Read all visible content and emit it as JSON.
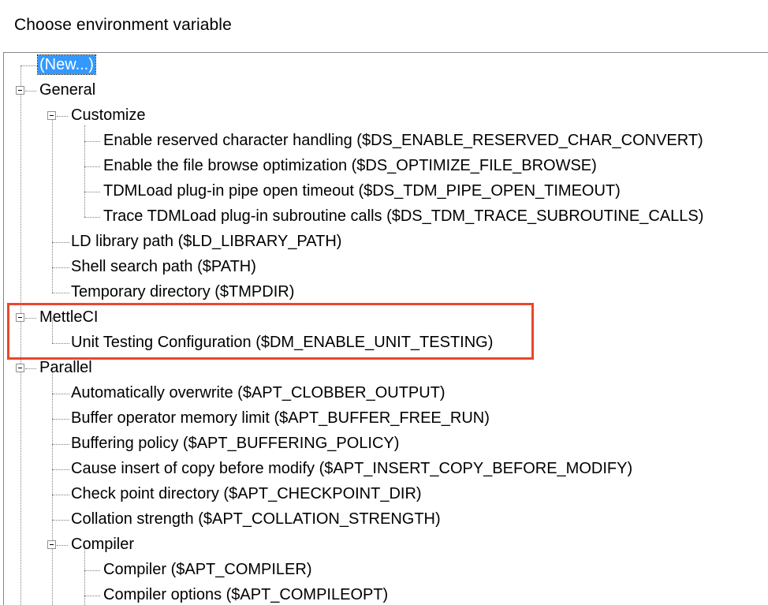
{
  "window": {
    "title": "Choose environment variable"
  },
  "tree": {
    "new_item": "(New...)",
    "general": {
      "label": "General",
      "customize": {
        "label": "Customize",
        "items": [
          "Enable reserved character handling ($DS_ENABLE_RESERVED_CHAR_CONVERT)",
          "Enable the file browse optimization ($DS_OPTIMIZE_FILE_BROWSE)",
          "TDMLoad plug-in pipe open timeout ($DS_TDM_PIPE_OPEN_TIMEOUT)",
          "Trace TDMLoad plug-in subroutine calls ($DS_TDM_TRACE_SUBROUTINE_CALLS)"
        ]
      },
      "items": [
        "LD library path ($LD_LIBRARY_PATH)",
        "Shell search path ($PATH)",
        "Temporary directory ($TMPDIR)"
      ]
    },
    "mettleci": {
      "label": "MettleCI",
      "items": [
        "Unit Testing Configuration ($DM_ENABLE_UNIT_TESTING)"
      ]
    },
    "parallel": {
      "label": "Parallel",
      "items": [
        "Automatically overwrite ($APT_CLOBBER_OUTPUT)",
        "Buffer operator memory limit ($APT_BUFFER_FREE_RUN)",
        "Buffering policy ($APT_BUFFERING_POLICY)",
        "Cause insert of copy before modify ($APT_INSERT_COPY_BEFORE_MODIFY)",
        "Check point directory ($APT_CHECKPOINT_DIR)",
        "Collation strength ($APT_COLLATION_STRENGTH)"
      ],
      "compiler": {
        "label": "Compiler",
        "items": [
          "Compiler ($APT_COMPILER)",
          "Compiler options ($APT_COMPILEOPT)"
        ]
      }
    }
  },
  "colors": {
    "selection": "#3399ff",
    "highlight_border": "#e8482c"
  }
}
